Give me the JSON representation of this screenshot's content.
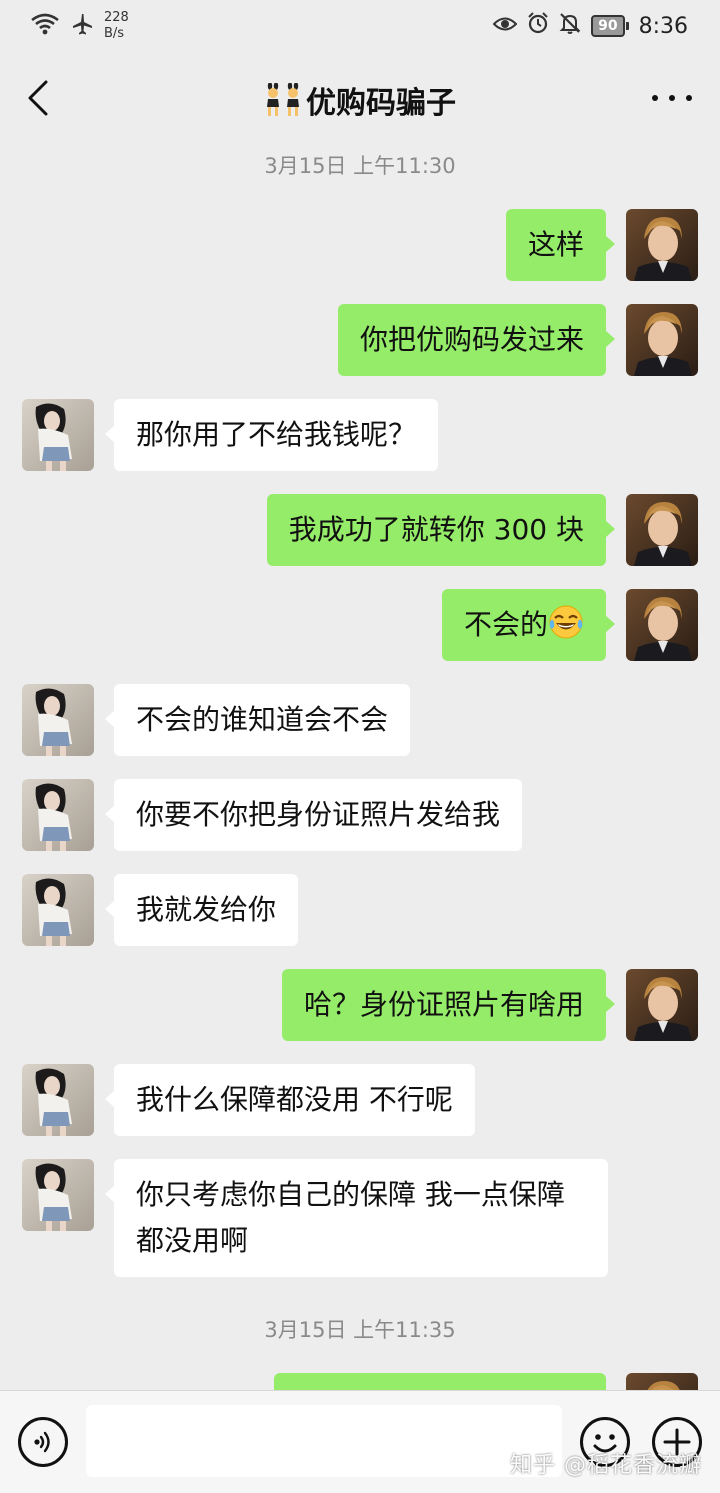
{
  "status_bar": {
    "speed_value": "228",
    "speed_unit": "B/s",
    "battery": "90",
    "time": "8:36",
    "icons": [
      "wifi-icon",
      "airplane-icon",
      "eye-icon",
      "alarm-icon",
      "mute-icon",
      "battery-icon"
    ]
  },
  "header": {
    "title": "优购码骗子",
    "title_emoji": "dancers-emoji"
  },
  "timestamps": [
    "3月15日 上午11:30",
    "3月15日 上午11:35"
  ],
  "messages": [
    {
      "from": "me",
      "text": "这样"
    },
    {
      "from": "me",
      "text": "你把优购码发过来"
    },
    {
      "from": "them",
      "text": "那你用了不给我钱呢？"
    },
    {
      "from": "me",
      "text": "我成功了就转你 300 块"
    },
    {
      "from": "me",
      "text": "不会的",
      "emoji": "tears-of-joy-emoji"
    },
    {
      "from": "them",
      "text": "不会的谁知道会不会"
    },
    {
      "from": "them",
      "text": "你要不你把身份证照片发给我"
    },
    {
      "from": "them",
      "text": "我就发给你"
    },
    {
      "from": "me",
      "text": "哈？身份证照片有啥用"
    },
    {
      "from": "them",
      "text": "我什么保障都没用 不行呢"
    },
    {
      "from": "them",
      "text": "你只考虑你自己的保障 我一点保障都没用啊"
    },
    {
      "from": "me",
      "text": ""
    }
  ],
  "bottom_bar": {
    "input_value": "",
    "watermark": "知乎 @稻花香流瓣"
  },
  "colors": {
    "my_bubble": "#95ec69",
    "their_bubble": "#ffffff",
    "background": "#ededed"
  }
}
